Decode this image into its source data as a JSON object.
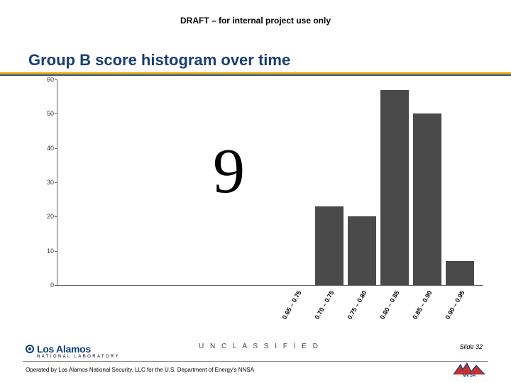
{
  "header": {
    "draft_banner": "DRAFT – for internal project use only",
    "title": "Group B score histogram over time"
  },
  "overlay": {
    "number": "9"
  },
  "footer": {
    "classification": "U N C L A S S I F I E D",
    "logo_text": "Los Alamos",
    "logo_sub": "NATIONAL LABORATORY",
    "operated_by": "Operated by Los Alamos National Security, LLC for the U.S. Department of Energy's NNSA",
    "slide_label": "Slide 32",
    "partner_logo_label": "NNSA"
  },
  "chart_data": {
    "type": "bar",
    "title": "Group B score histogram over time",
    "xlabel": "",
    "ylabel": "",
    "ylim": [
      0,
      60
    ],
    "yticks": [
      0,
      10,
      20,
      30,
      40,
      50,
      60
    ],
    "categories": [
      "0.65 – 0.75",
      "0.70 – 0.75",
      "0.75 – 0.80",
      "0.80 – 0.85",
      "0.85 – 0.90",
      "0.90 – 0.95"
    ],
    "values": [
      0,
      23,
      20,
      57,
      50,
      7
    ],
    "bar_color": "#4a4a4a"
  }
}
